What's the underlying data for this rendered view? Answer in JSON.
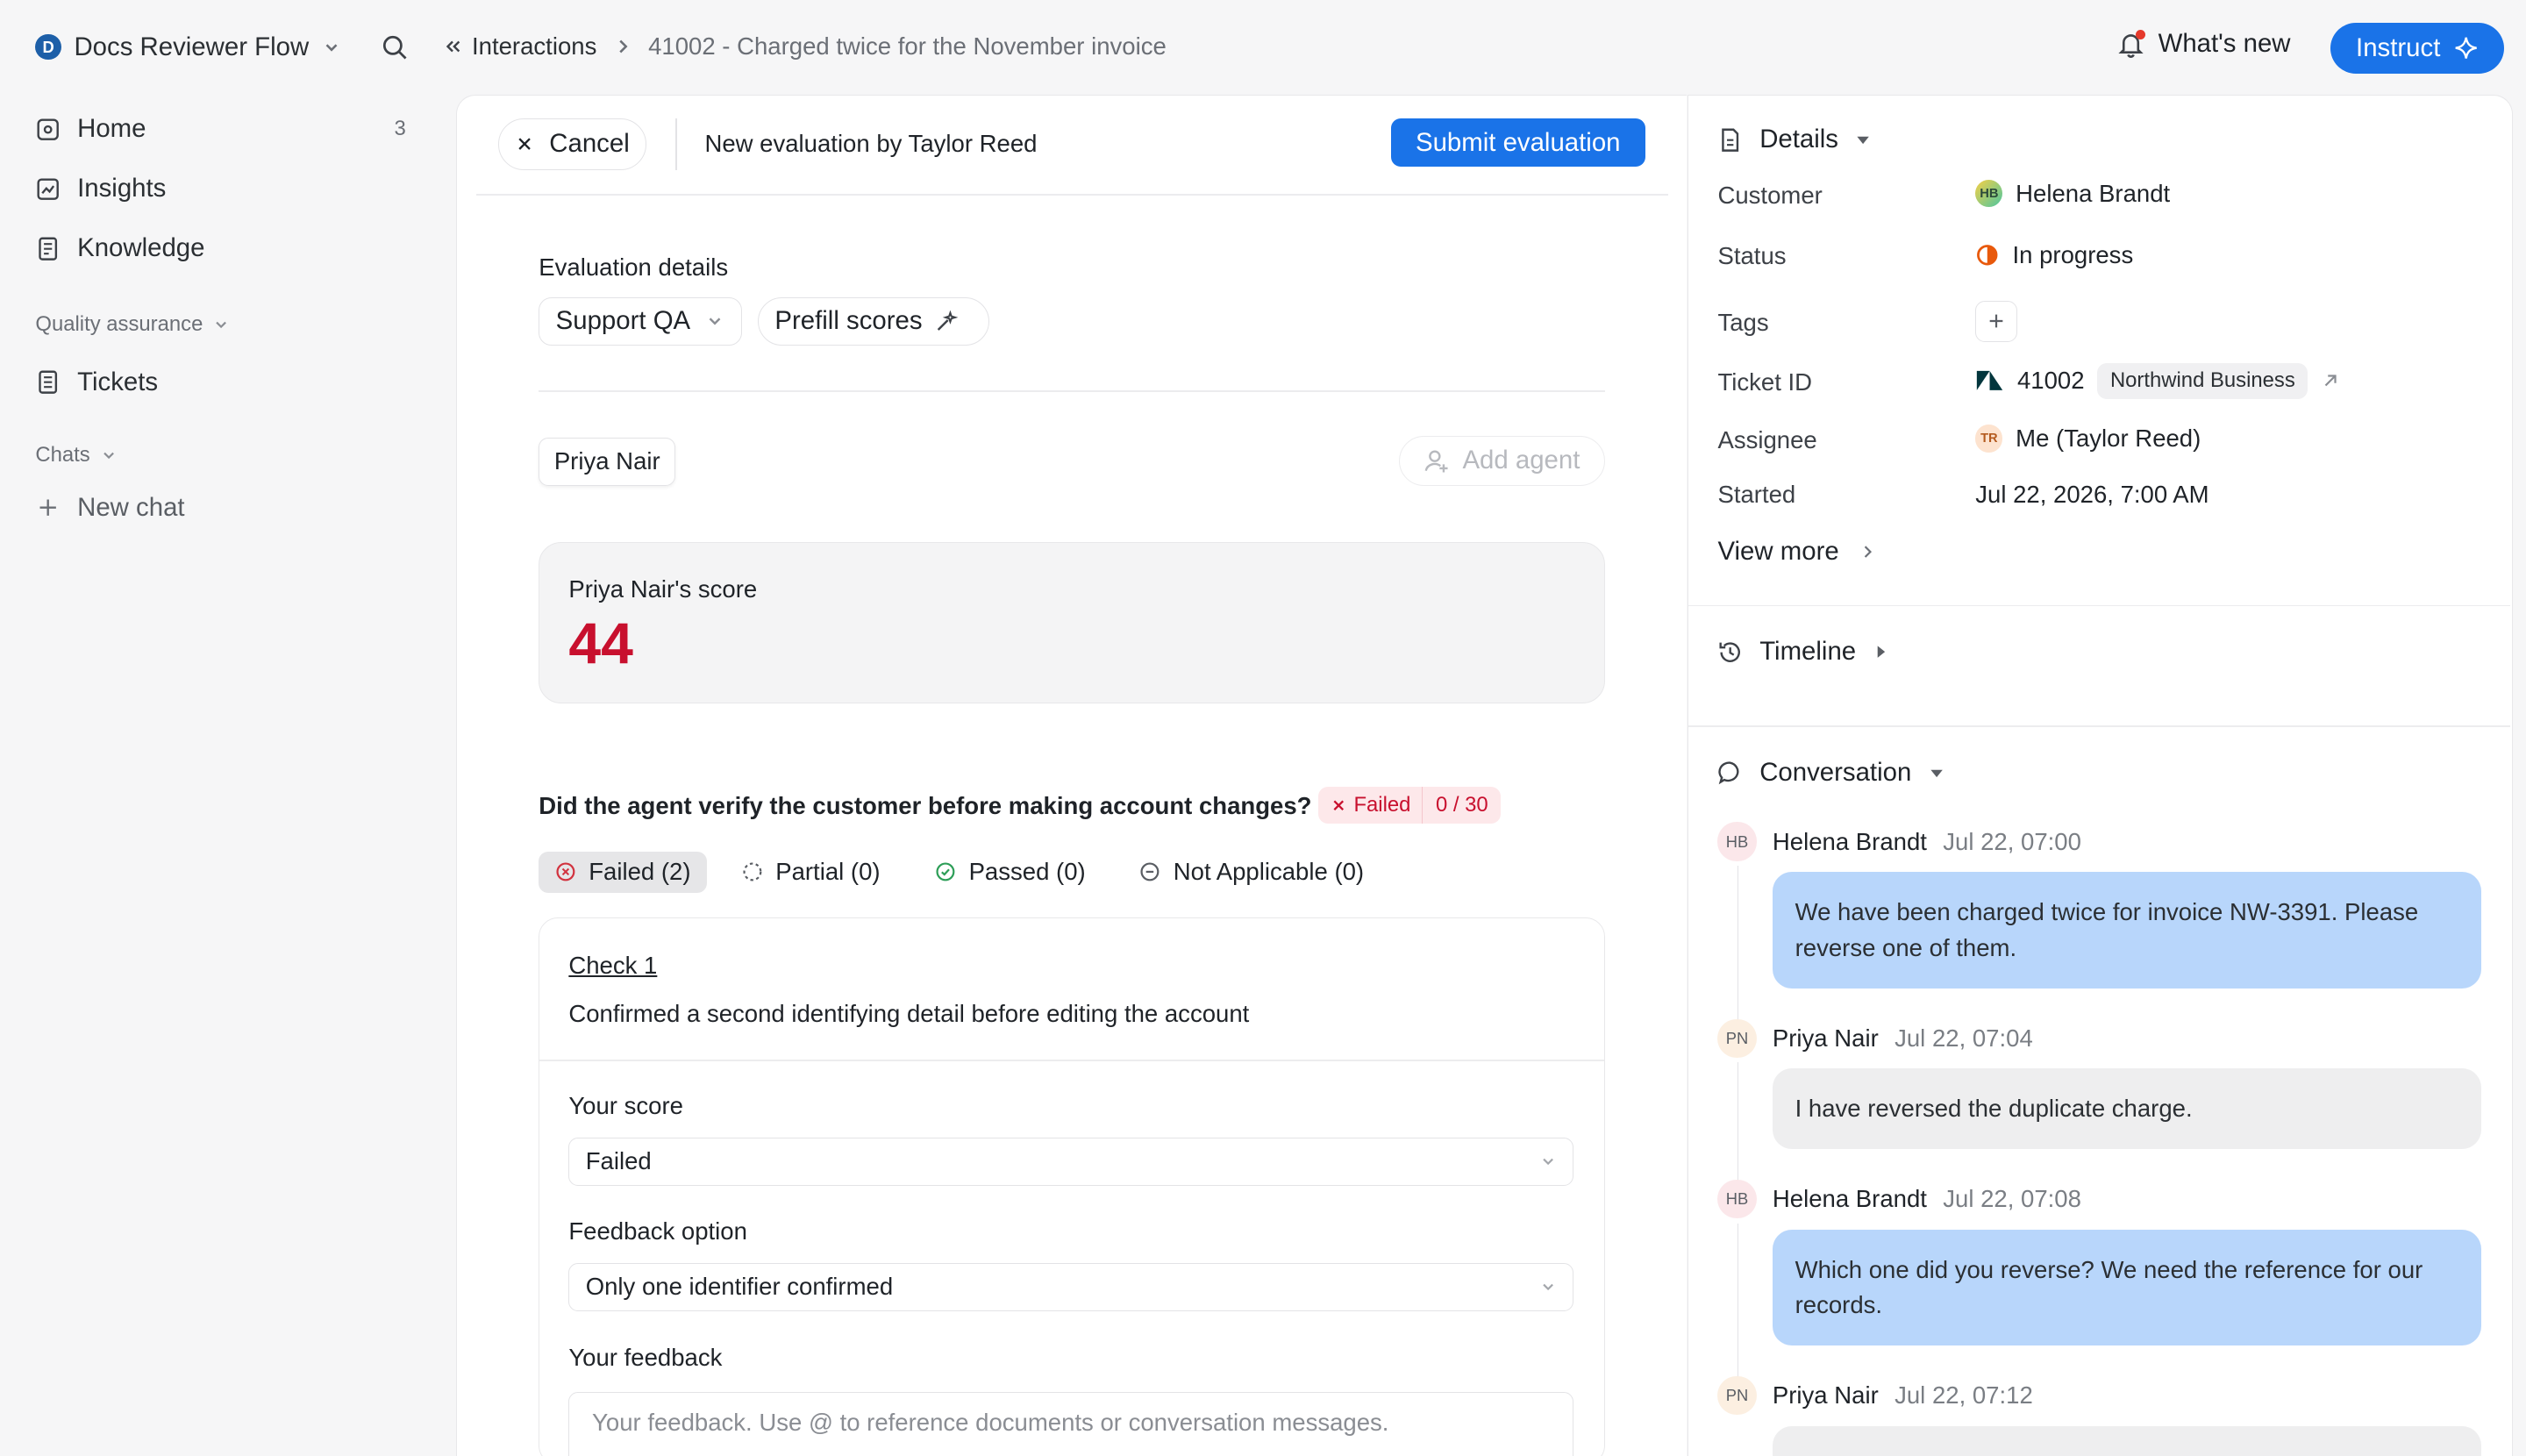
{
  "workspace": {
    "initial": "D",
    "name": "Docs Reviewer Flow"
  },
  "breadcrumb": {
    "parent": "Interactions",
    "current": "41002 - Charged twice for the November invoice"
  },
  "topbar": {
    "whats_new": "What's new",
    "instruct": "Instruct"
  },
  "sidebar": {
    "items": [
      {
        "label": "Home",
        "count": "3",
        "icon": "home-icon"
      },
      {
        "label": "Insights",
        "icon": "insights-icon"
      },
      {
        "label": "Knowledge",
        "icon": "book-icon"
      }
    ],
    "qa_section": "Quality assurance",
    "qa_items": [
      {
        "label": "Tickets",
        "icon": "ticket-icon"
      }
    ],
    "chats_section": "Chats",
    "new_chat": "New chat"
  },
  "evaluation": {
    "cancel": "Cancel",
    "title": "New evaluation by Taylor Reed",
    "submit": "Submit evaluation",
    "details_label": "Evaluation details",
    "scorecard": "Support QA",
    "prefill": "Prefill scores",
    "agent": "Priya Nair",
    "add_agent": "Add agent",
    "score_label": "Priya Nair's score",
    "score_value": "44",
    "question": "Did the agent verify the customer before making account changes?",
    "question_status": "Failed",
    "question_points": "0 / 30",
    "filters": [
      {
        "label": "Failed (2)",
        "icon": "x-circle-icon"
      },
      {
        "label": "Partial (0)",
        "icon": "dashed-circle-icon"
      },
      {
        "label": "Passed (0)",
        "icon": "check-circle-icon"
      },
      {
        "label": "Not Applicable (0)",
        "icon": "minus-circle-icon"
      }
    ],
    "check": {
      "title": "Check 1",
      "description": "Confirmed a second identifying detail before editing the account",
      "score_label": "Your score",
      "score_value": "Failed",
      "feedback_option_label": "Feedback option",
      "feedback_option_value": "Only one identifier confirmed",
      "feedback_label": "Your feedback",
      "feedback_placeholder": "Your feedback. Use @ to reference documents or conversation messages."
    }
  },
  "details": {
    "heading": "Details",
    "customer_label": "Customer",
    "customer": {
      "initials": "HB",
      "name": "Helena Brandt"
    },
    "status_label": "Status",
    "status": "In progress",
    "tags_label": "Tags",
    "ticket_label": "Ticket ID",
    "ticket_id": "41002",
    "ticket_org": "Northwind Business",
    "assignee_label": "Assignee",
    "assignee": {
      "initials": "TR",
      "name": "Me (Taylor Reed)"
    },
    "started_label": "Started",
    "started": "Jul 22, 2026, 7:00 AM",
    "view_more": "View more"
  },
  "timeline": {
    "heading": "Timeline"
  },
  "conversation": {
    "heading": "Conversation",
    "messages": [
      {
        "initials": "HB",
        "author": "Helena Brandt",
        "time": "Jul 22, 07:00",
        "text": "We have been charged twice for invoice NW-3391. Please reverse one of them.",
        "role": "customer"
      },
      {
        "initials": "PN",
        "author": "Priya Nair",
        "time": "Jul 22, 07:04",
        "text": "I have reversed the duplicate charge.",
        "role": "agent"
      },
      {
        "initials": "HB",
        "author": "Helena Brandt",
        "time": "Jul 22, 07:08",
        "text": "Which one did you reverse? We need the reference for our records.",
        "role": "customer"
      },
      {
        "initials": "PN",
        "author": "Priya Nair",
        "time": "Jul 22, 07:12",
        "text": "",
        "role": "agent"
      }
    ]
  },
  "colors": {
    "accent": "#1a73e8",
    "fail": "#c8102e",
    "status_in_progress": "#e8590c",
    "customer_bubble": "#b8d6fb"
  }
}
